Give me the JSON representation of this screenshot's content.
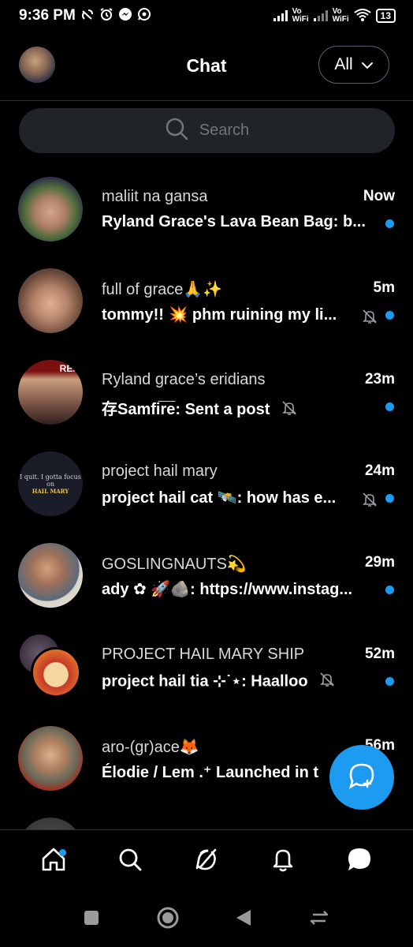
{
  "status_bar": {
    "time": "9:36 PM",
    "battery": "13",
    "vowifi_1": "Vo\nWiFi",
    "vowifi_2": "Vo\nWiFi"
  },
  "header": {
    "title": "Chat",
    "filter_label": "All"
  },
  "search": {
    "placeholder": "Search"
  },
  "chats": [
    {
      "name": "maliit na gansa",
      "time": "Now",
      "preview": "Ryland Grace's Lava Bean Bag: b...",
      "muted": false,
      "unread": true
    },
    {
      "name": "full of grace🙏✨",
      "time": "5m",
      "preview": "tommy!! 💥 phm ruining my li...",
      "muted": true,
      "unread": true
    },
    {
      "name": "Ryland grace’s eridians",
      "time": "23m",
      "preview": "存Samfir̅e̅: Sent a post",
      "muted": true,
      "unread": true
    },
    {
      "name": "project hail mary",
      "time": "24m",
      "preview": "project hail cat 🛰️: how has e...",
      "muted": true,
      "unread": true
    },
    {
      "name": "GOSLINGNAUTS💫",
      "time": "29m",
      "preview": "ady ✿ 🚀🪨: https://www.instag...",
      "muted": false,
      "unread": true
    },
    {
      "name": "PROJECT HAIL MARY SHIP",
      "time": "52m",
      "preview": "project hail tia ⊹˙⋆: Haalloo",
      "muted": true,
      "unread": true
    },
    {
      "name": "aro-(gr)ace🦊",
      "time": "56m",
      "preview": "Élodie / Lem .⁺ Launched in t",
      "muted": false,
      "unread": false
    }
  ],
  "avatar_text": {
    "eridians": "REA",
    "phm_line1": "I quit. I gotta focus",
    "phm_line2": "on",
    "phm_line3": "HAIL MARY"
  },
  "colors": {
    "accent": "#1d9bf0",
    "background": "#000000",
    "search_bg": "#202327",
    "divider": "#2f3336"
  },
  "icons": {
    "search": "search-icon",
    "chevron": "chevron-down-icon",
    "mute": "bell-slash-icon",
    "compose": "new-message-icon",
    "nav": [
      "home-icon",
      "search-icon",
      "grok-icon",
      "notifications-icon",
      "messages-icon"
    ],
    "android": [
      "recents-icon",
      "home-button-icon",
      "back-icon",
      "rotate-icon"
    ]
  }
}
